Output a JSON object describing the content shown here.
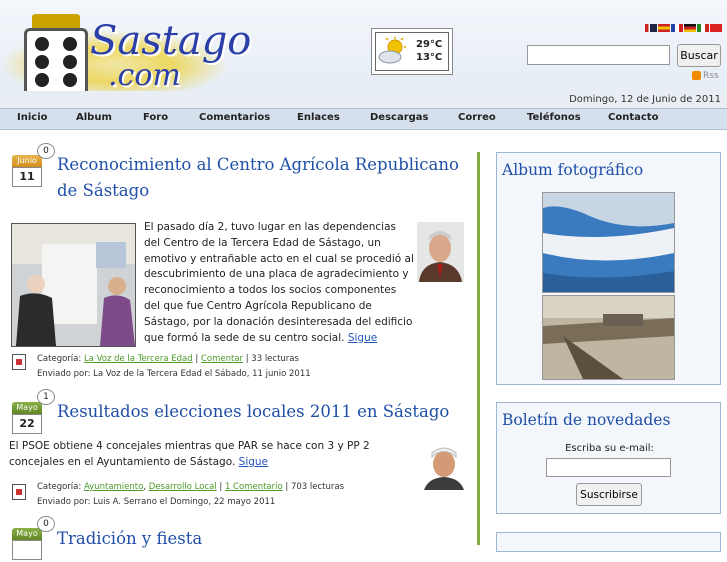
{
  "header": {
    "logo_line1": "Sastago",
    "logo_line2": ".com",
    "weather": {
      "max": "29°C",
      "min": "13°C",
      "icon": "sun-cloud-icon"
    },
    "search": {
      "button_label": "Buscar",
      "value": ""
    },
    "rss_label": "Rss",
    "date": "Domingo, 12 de Junio de 2011",
    "flags": [
      "flag-uk",
      "flag-es",
      "flag-fr",
      "flag-de",
      "flag-it",
      "flag-cn"
    ]
  },
  "nav": [
    "Inicio",
    "Album",
    "Foro",
    "Comentarios",
    "Enlaces",
    "Descargas",
    "Correo",
    "Teléfonos",
    "Contacto"
  ],
  "posts": [
    {
      "month": "Junio",
      "day": "11",
      "comments": "0",
      "title": "Reconocimiento al Centro Agrícola Republicano de Sástago",
      "body": "El pasado día 2, tuvo lugar en las dependencias del Centro de la Tercera Edad de Sástago, un emotivo y entrañable acto en el cual se procedió al descubrimiento de una placa de agradecimiento y reconocimiento a todos los socios componentes del que fue Centro Agrícola Republicano de Sástago, por la donación desinteresada del edificio que formó la sede de su centro social.",
      "more": "Sigue",
      "category_label": "Categoría:",
      "categories": [
        "La Voz de la Tercera Edad"
      ],
      "comment_link": "Comentar",
      "reads": "| 33 lecturas",
      "sent": "Enviado por: La Voz de la Tercera Edad el Sábado, 11 junio 2011"
    },
    {
      "month": "Mayo",
      "day": "22",
      "comments": "1",
      "title": "Resultados elecciones locales 2011 en Sástago",
      "body": "El PSOE obtiene 4 concejales mientras que PAR se hace con 3 y PP 2 concejales en el Ayuntamiento de Sástago.",
      "more": "Sigue",
      "category_label": "Categoría:",
      "categories": [
        "Ayuntamiento",
        "Desarrollo Local"
      ],
      "comment_link": "1 Comentario",
      "reads": "| 703 lecturas",
      "sent": "Enviado por: Luis A. Serrano el Domingo, 22 mayo 2011"
    },
    {
      "month": "Mayo",
      "day": "",
      "comments": "0",
      "title": "Tradición y fiesta"
    }
  ],
  "sidebar": {
    "album_title": "Album fotográfico",
    "newsletter_title": "Boletín de novedades",
    "newsletter_label": "Escriba su e-mail:",
    "subscribe_label": "Suscribirse"
  }
}
